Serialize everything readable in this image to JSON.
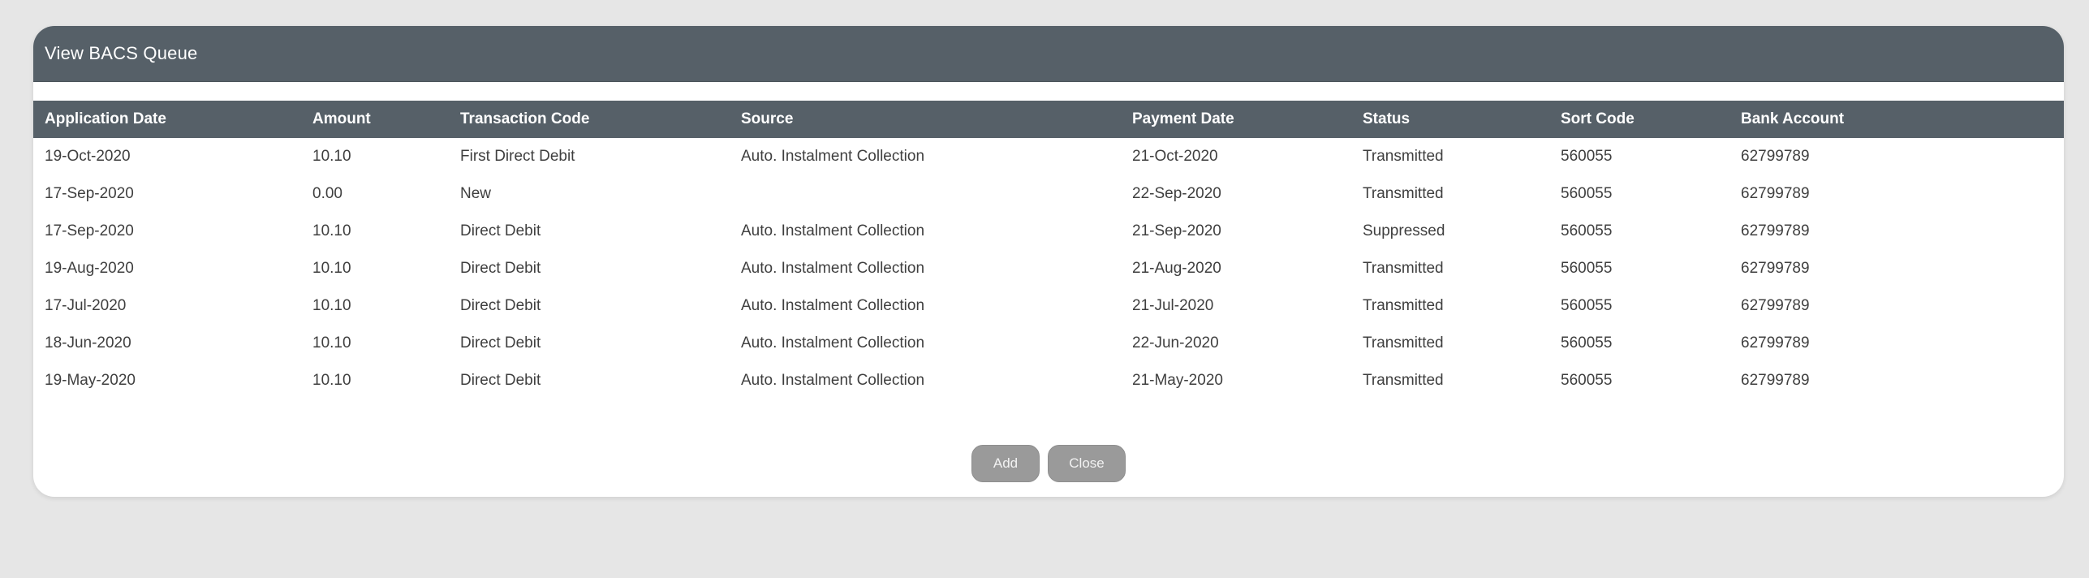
{
  "dialog": {
    "title": "View BACS Queue"
  },
  "table": {
    "columns": [
      "Application Date",
      "Amount",
      "Transaction Code",
      "Source",
      "Payment Date",
      "Status",
      "Sort Code",
      "Bank Account"
    ],
    "rows": [
      [
        "19-Oct-2020",
        "10.10",
        "First Direct Debit",
        "Auto. Instalment Collection",
        "21-Oct-2020",
        "Transmitted",
        "560055",
        "62799789"
      ],
      [
        "17-Sep-2020",
        "0.00",
        "New",
        "",
        "22-Sep-2020",
        "Transmitted",
        "560055",
        "62799789"
      ],
      [
        "17-Sep-2020",
        "10.10",
        "Direct Debit",
        "Auto. Instalment Collection",
        "21-Sep-2020",
        "Suppressed",
        "560055",
        "62799789"
      ],
      [
        "19-Aug-2020",
        "10.10",
        "Direct Debit",
        "Auto. Instalment Collection",
        "21-Aug-2020",
        "Transmitted",
        "560055",
        "62799789"
      ],
      [
        "17-Jul-2020",
        "10.10",
        "Direct Debit",
        "Auto. Instalment Collection",
        "21-Jul-2020",
        "Transmitted",
        "560055",
        "62799789"
      ],
      [
        "18-Jun-2020",
        "10.10",
        "Direct Debit",
        "Auto. Instalment Collection",
        "22-Jun-2020",
        "Transmitted",
        "560055",
        "62799789"
      ],
      [
        "19-May-2020",
        "10.10",
        "Direct Debit",
        "Auto. Instalment Collection",
        "21-May-2020",
        "Transmitted",
        "560055",
        "62799789"
      ]
    ]
  },
  "buttons": {
    "add_label": "Add",
    "close_label": "Close"
  },
  "colors": {
    "header_bg": "#566068",
    "page_bg": "#e6e6e6",
    "button_bg": "#9a9a9a"
  }
}
